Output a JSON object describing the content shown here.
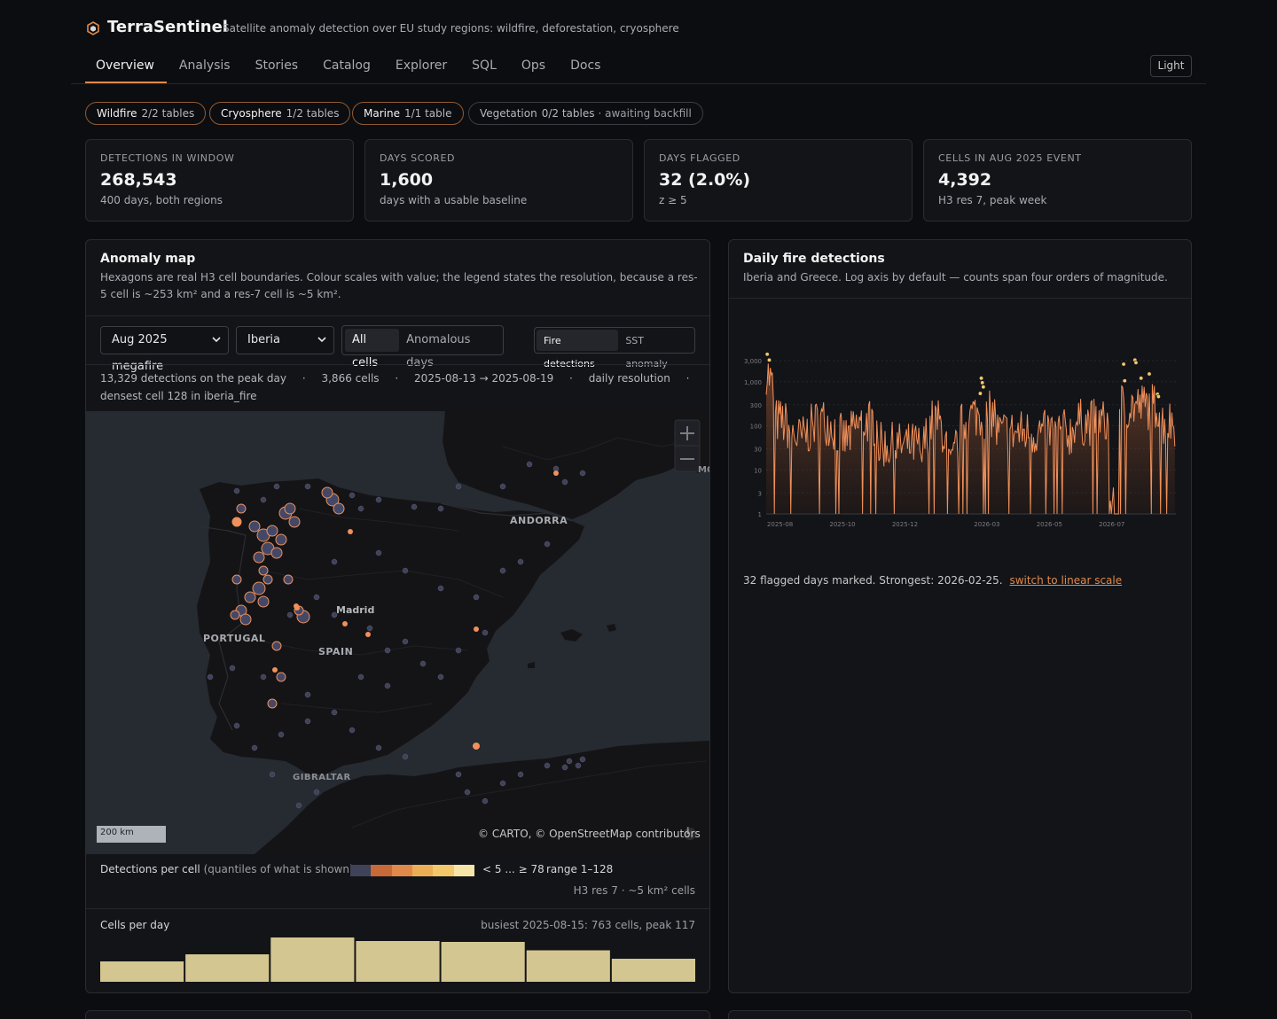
{
  "app": {
    "name": "TerraSentinel",
    "subtitle": "Satellite anomaly detection over EU study regions: wildfire, deforestation, cryosphere"
  },
  "nav": {
    "tabs": [
      "Overview",
      "Analysis",
      "Stories",
      "Catalog",
      "Explorer",
      "SQL",
      "Ops",
      "Docs"
    ],
    "active": "Overview",
    "theme_button": "Light"
  },
  "chips": [
    {
      "name": "Wildfire",
      "count": "2/2 tables"
    },
    {
      "name": "Cryosphere",
      "count": "1/2 tables"
    },
    {
      "name": "Marine",
      "count": "1/1 table"
    },
    {
      "name": "Vegetation",
      "count": "0/2 tables",
      "note": "· awaiting backfill"
    }
  ],
  "stats": [
    {
      "label": "Detections in window",
      "value": "268,543",
      "sub": "400 days, both regions"
    },
    {
      "label": "Days scored",
      "value": "1,600",
      "sub": "days with a usable baseline"
    },
    {
      "label": "Days flagged",
      "value": "32 (2.0%)",
      "sub": "z ≥ 5"
    },
    {
      "label": "Cells in Aug 2025 event",
      "value": "4,392",
      "sub": "H3 res 7, peak week"
    }
  ],
  "map_panel": {
    "title": "Anomaly map",
    "description": "Hexagons are real H3 cell boundaries. Colour scales with value; the legend states the resolution, because a res-5 cell is ~253 km² and a res-7 cell is ~5 km².",
    "event_select": "Aug 2025 megafire",
    "region_select": "Iberia",
    "cell_filter": [
      "All cells",
      "Anomalous days"
    ],
    "layer_toggle": [
      "Fire detections",
      "SST anomaly"
    ],
    "meta": {
      "peak": "13,329 detections on the peak day",
      "cells": "3,866 cells",
      "dates": "2025-08-13 → 2025-08-19",
      "resolution": "daily resolution",
      "densest": "densest cell 128 in iberia_fire"
    },
    "map_labels": {
      "andorra": "ANDORRA",
      "portugal": "PORTUGAL",
      "spain": "SPAIN",
      "madrid": "Madrid",
      "gibraltar": "GIBRALTAR",
      "edge": "MO"
    },
    "scale": "200 km",
    "attribution": "© CARTO, © OpenStreetMap contributors",
    "legend": {
      "label": "Detections per cell",
      "qualifier": "(quantiles of what is shown)",
      "colors": [
        "#3f4258",
        "#c8693a",
        "#e0894a",
        "#ecae55",
        "#f3c86a",
        "#f6e4a8"
      ],
      "range_text": "< 5 ... ≥ 78",
      "range": "range 1–128",
      "resolution_note": "H3 res 7 · ~5 km² cells"
    },
    "cells_per_day": {
      "title": "Cells per day",
      "busiest": "busiest 2025-08-15: 763 cells, peak 117",
      "values": [
        0.46,
        0.62,
        1.0,
        0.92,
        0.9,
        0.71,
        0.52
      ],
      "bar_color": "#d4c690"
    }
  },
  "fire_panel": {
    "title": "Daily fire detections",
    "description": "Iberia and Greece. Log axis by default — counts span four orders of magnitude.",
    "footer": "32 flagged days marked. Strongest: 2026-02-25.",
    "link": "switch to linear scale"
  },
  "chart_data": {
    "type": "area",
    "title": "Daily fire detections",
    "yscale": "log",
    "ylim": [
      1,
      5000
    ],
    "yticks": [
      "1",
      "3",
      "10",
      "30",
      "100",
      "300",
      "1,000",
      "3,000"
    ],
    "ytick_values": [
      1,
      3,
      10,
      30,
      100,
      300,
      1000,
      3000
    ],
    "xticks": [
      "2025-08",
      "2025-10",
      "2025-12",
      "2026-03",
      "2026-05",
      "2026-07"
    ],
    "xtick_days": [
      10,
      71,
      132,
      212,
      273,
      334
    ],
    "x_range_days": [
      0,
      400
    ],
    "series_color": "#f0905a",
    "series": [
      {
        "values": []
      }
    ],
    "flagged": [
      {
        "day": 1,
        "value": 4200
      },
      {
        "day": 3,
        "value": 3100
      },
      {
        "day": 210,
        "value": 1200
      },
      {
        "day": 211,
        "value": 950
      },
      {
        "day": 212,
        "value": 760
      },
      {
        "day": 209,
        "value": 540
      },
      {
        "day": 349,
        "value": 2500
      },
      {
        "day": 350,
        "value": 1050
      },
      {
        "day": 360,
        "value": 3100
      },
      {
        "day": 361,
        "value": 2700
      },
      {
        "day": 366,
        "value": 1200
      },
      {
        "day": 374,
        "value": 1500
      },
      {
        "day": 382,
        "value": 520
      },
      {
        "day": 383,
        "value": 460
      }
    ]
  }
}
